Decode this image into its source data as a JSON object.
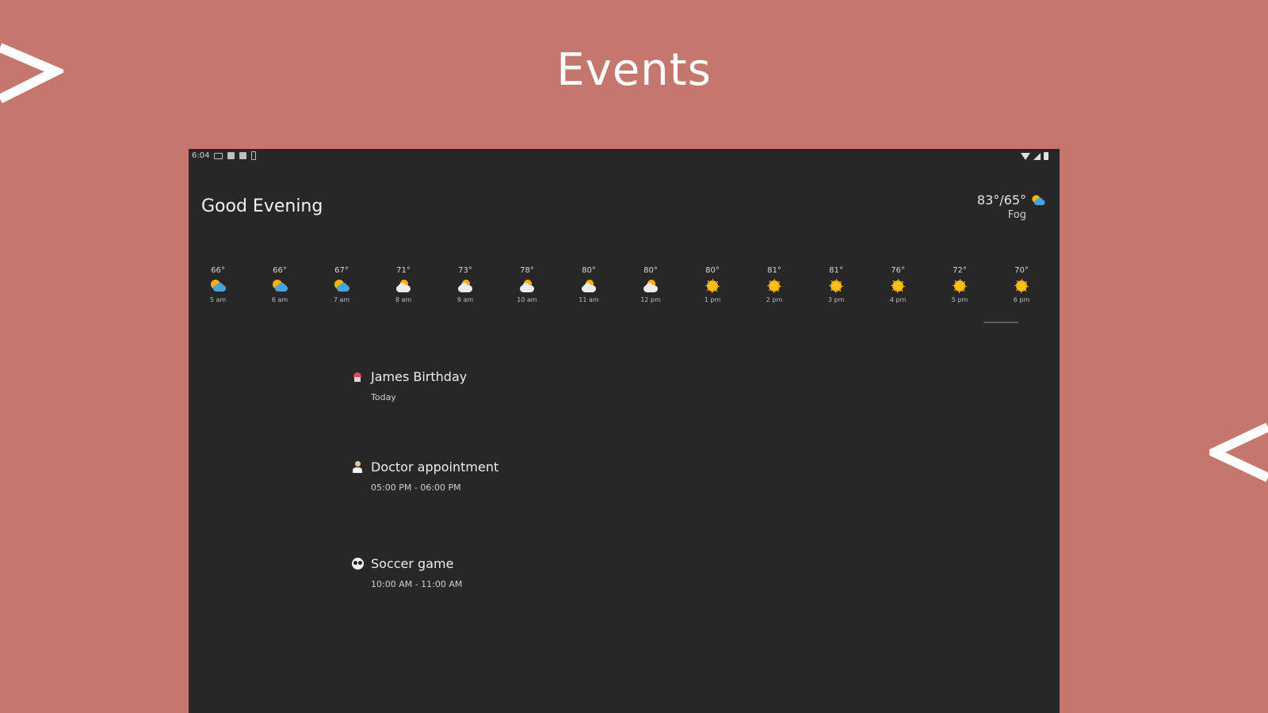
{
  "promo": {
    "title": "Events"
  },
  "status_bar": {
    "time": "6:04"
  },
  "header": {
    "greeting": "Good Evening",
    "current_temp": "83°/65°",
    "current_condition": "Fog",
    "current_icon": "partly-sunny-icon"
  },
  "hourly": [
    {
      "temp": "66°",
      "time": "5 am",
      "icon": "partly"
    },
    {
      "temp": "66°",
      "time": "6 am",
      "icon": "partly"
    },
    {
      "temp": "67°",
      "time": "7 am",
      "icon": "partly"
    },
    {
      "temp": "71°",
      "time": "8 am",
      "icon": "cloudy"
    },
    {
      "temp": "73°",
      "time": "9 am",
      "icon": "cloudy"
    },
    {
      "temp": "78°",
      "time": "10 am",
      "icon": "cloudy"
    },
    {
      "temp": "80°",
      "time": "11 am",
      "icon": "cloudy"
    },
    {
      "temp": "80°",
      "time": "12 pm",
      "icon": "cloudy"
    },
    {
      "temp": "80°",
      "time": "1 pm",
      "icon": "sunny"
    },
    {
      "temp": "81°",
      "time": "2 pm",
      "icon": "sunny"
    },
    {
      "temp": "81°",
      "time": "3 pm",
      "icon": "sunny"
    },
    {
      "temp": "76°",
      "time": "4 pm",
      "icon": "sunny"
    },
    {
      "temp": "72°",
      "time": "5 pm",
      "icon": "sunny"
    },
    {
      "temp": "70°",
      "time": "6 pm",
      "icon": "sunny"
    }
  ],
  "events": [
    {
      "title": "James Birthday",
      "subtitle": "Today",
      "icon": "cupcake-icon"
    },
    {
      "title": "Doctor appointment",
      "subtitle": "05:00 PM - 06:00 PM",
      "icon": "doctor-icon"
    },
    {
      "title": "Soccer game",
      "subtitle": "10:00 AM - 11:00 AM",
      "icon": "soccer-ball-icon"
    }
  ],
  "colors": {
    "background": "#c5776d",
    "device": "#272727",
    "text": "#eeeeee"
  }
}
